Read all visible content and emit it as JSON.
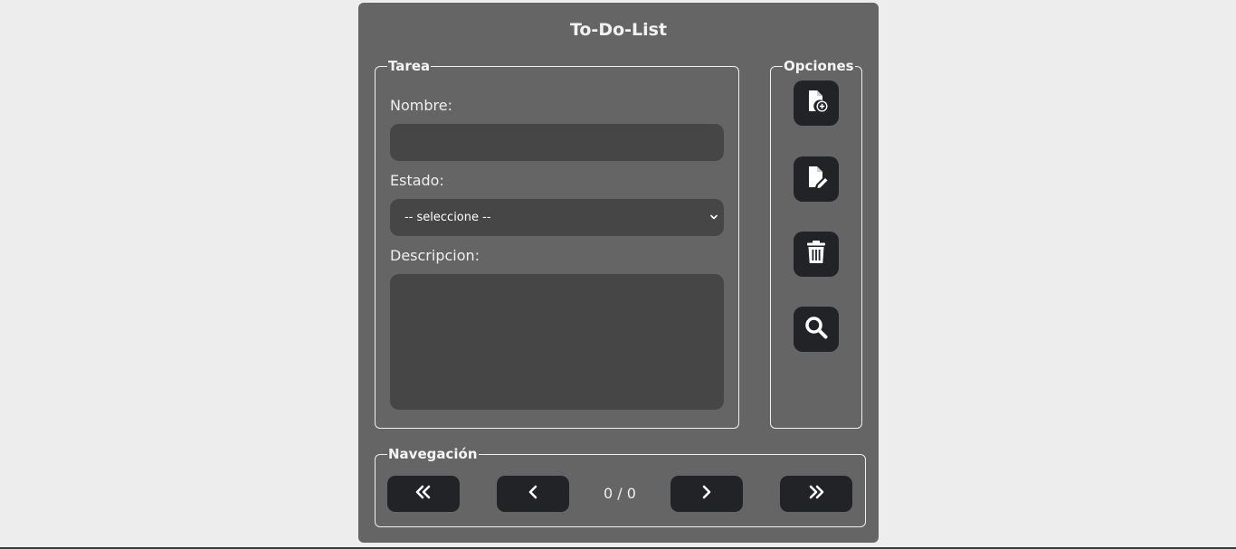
{
  "app": {
    "title": "To-Do-List"
  },
  "tarea": {
    "legend": "Tarea",
    "nombre_label": "Nombre:",
    "nombre_value": "",
    "estado_label": "Estado:",
    "estado_selected": "-- seleccione --",
    "descripcion_label": "Descripcion:",
    "descripcion_value": ""
  },
  "opciones": {
    "legend": "Opciones",
    "buttons": [
      {
        "icon": "file-add-icon"
      },
      {
        "icon": "file-edit-icon"
      },
      {
        "icon": "trash-icon"
      },
      {
        "icon": "search-icon"
      }
    ]
  },
  "navegacion": {
    "legend": "Navegación",
    "counter": "0 / 0",
    "buttons": [
      {
        "icon": "double-chevron-left-icon"
      },
      {
        "icon": "chevron-left-icon"
      },
      {
        "icon": "chevron-right-icon"
      },
      {
        "icon": "double-chevron-right-icon"
      }
    ]
  },
  "colors": {
    "page_background": "#ededed",
    "panel_background": "#656565",
    "field_background": "#464646",
    "button_background": "#212327",
    "text": "#f0f0f0"
  }
}
